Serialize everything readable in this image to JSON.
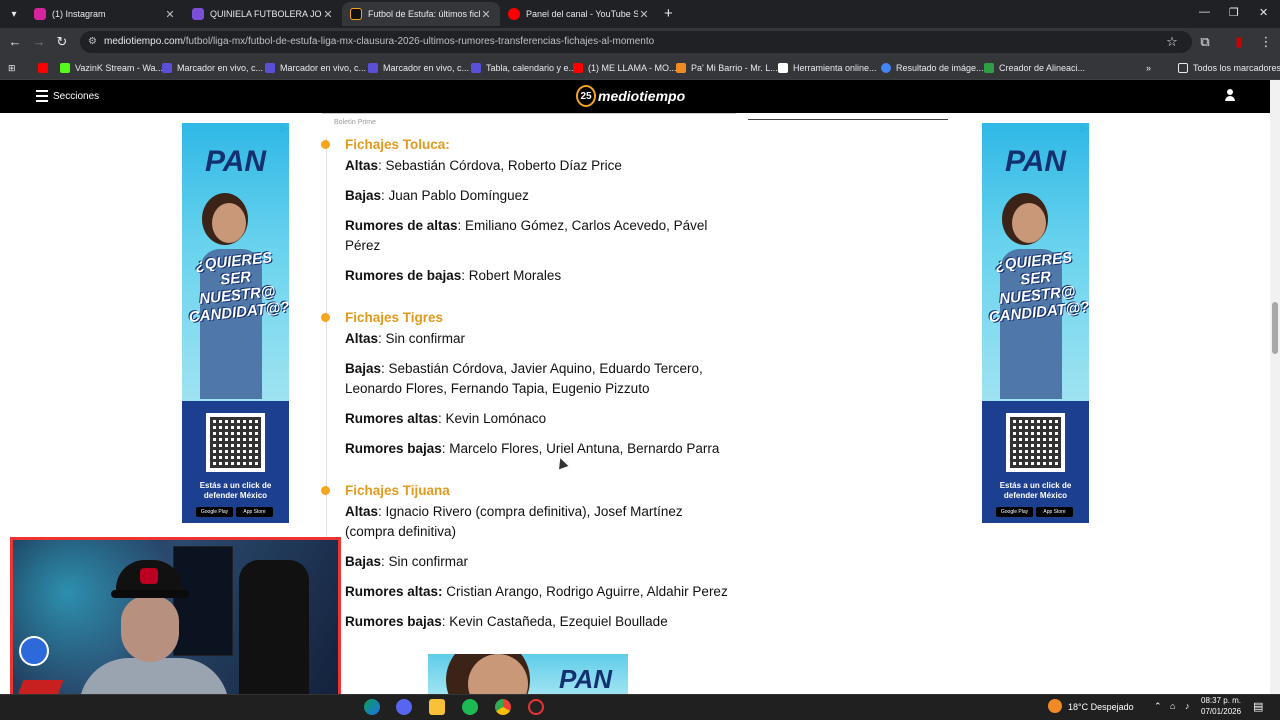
{
  "browser": {
    "tabs": [
      {
        "label": "(1) Instagram",
        "color": "#d6249f",
        "active": false
      },
      {
        "label": "QUINIELA FUTBOLERA JORNADA",
        "color": "#7b4fd8",
        "active": false
      },
      {
        "label": "Futbol de Estufa: últimos fichajes",
        "color": "#111111",
        "active": true
      },
      {
        "label": "Panel del canal - YouTube Studio",
        "color": "#ff0000",
        "active": false
      }
    ],
    "new_tab": "+",
    "url_host": "mediotiempo.com",
    "url_path": "/futbol/liga-mx/futbol-de-estufa-liga-mx-clausura-2026-ultimos-rumores-transferencias-fichajes-al-momento",
    "bookmarks": [
      {
        "label": "",
        "color": "#ff0000"
      },
      {
        "label": "VazinK Stream - Wa...",
        "color": "#53fc18"
      },
      {
        "label": "Marcador en vivo, c...",
        "color": "#5b4fd8"
      },
      {
        "label": "Marcador en vivo, c...",
        "color": "#5b4fd8"
      },
      {
        "label": "Marcador en vivo, c...",
        "color": "#5b4fd8"
      },
      {
        "label": "Tabla, calendario y e...",
        "color": "#5b4fd8"
      },
      {
        "label": "(1) ME LLAMA - MO...",
        "color": "#ff0000"
      },
      {
        "label": "Pa' Mi Barrio - Mr. L...",
        "color": "#f08a24"
      },
      {
        "label": "Herramienta online...",
        "color": "#ffffff"
      },
      {
        "label": "Resultado de imáge...",
        "color": "#4285f4"
      },
      {
        "label": "Creador de Alineaci...",
        "color": "#2ea043"
      }
    ],
    "bookmarks_more": "»",
    "all_bookmarks": "Todos los marcadores"
  },
  "site": {
    "sections_label": "Secciones",
    "logo_number": "25",
    "logo_text": "mediotiempo",
    "kicker": "Boletín Prime"
  },
  "article": {
    "blocks": [
      {
        "title": "Fichajes Toluca:",
        "lines": [
          {
            "label": "Altas",
            "text": ": Sebastián Córdova, Roberto Díaz Price"
          },
          {
            "label": "Bajas",
            "text": ": Juan Pablo Domínguez"
          },
          {
            "label": "Rumores de altas",
            "text": ": Emiliano Gómez, Carlos Acevedo, Pável Pérez"
          },
          {
            "label": "Rumores de bajas",
            "text": ": Robert Morales"
          }
        ]
      },
      {
        "title": "Fichajes Tigres",
        "lines": [
          {
            "label": "Altas",
            "text": ": Sin confirmar"
          },
          {
            "label": "Bajas",
            "text": ": Sebastián Córdova, Javier Aquino, Eduardo Tercero, Leonardo Flores, Fernando Tapia, Eugenio Pizzuto"
          },
          {
            "label": "Rumores altas",
            "text": ": Kevin Lomónaco"
          },
          {
            "label": "Rumores bajas",
            "text": ": Marcelo Flores, Uriel Antuna, Bernardo Parra"
          }
        ]
      },
      {
        "title": "Fichajes Tijuana",
        "lines": [
          {
            "label": "Altas",
            "text": ": Ignacio Rivero (compra definitiva), Josef Martínez (compra definitiva)"
          },
          {
            "label": "Bajas",
            "text": ": Sin confirmar"
          },
          {
            "label": "Rumores altas:",
            "text": " Cristian Arango, Rodrigo Aguirre, Aldahir Perez"
          },
          {
            "label": "Rumores bajas",
            "text": ": Kevin Castañeda, Ezequiel Boullade"
          }
        ]
      }
    ]
  },
  "ad": {
    "brand": "PAN",
    "promo": "¿QUIERES SER NUESTR@ CANDIDAT@?",
    "cta": "Estás a un click de defender México",
    "google_play": "Google Play",
    "app_store": "App Store",
    "ad_choice": "▷"
  },
  "taskbar": {
    "weather": "18°C  Despejado",
    "time": "08:37 p. m.",
    "date": "07/01/2026"
  }
}
